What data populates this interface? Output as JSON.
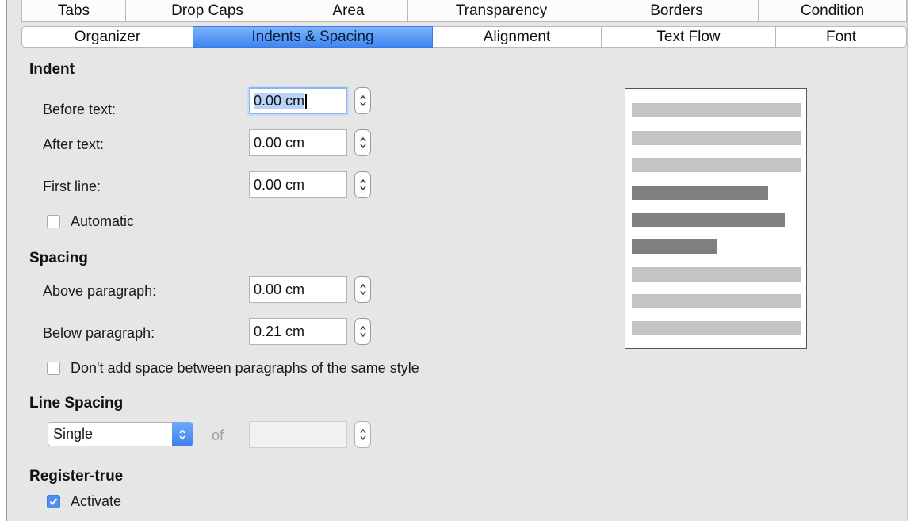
{
  "tabs_top": [
    "Tabs",
    "Drop Caps",
    "Area",
    "Transparency",
    "Borders",
    "Condition"
  ],
  "tabs_bottom": [
    "Organizer",
    "Indents & Spacing",
    "Alignment",
    "Text Flow",
    "Font"
  ],
  "active_tab": "Indents & Spacing",
  "indent": {
    "title": "Indent",
    "before_label": "Before text:",
    "before_value": "0.00 cm",
    "after_label": "After text:",
    "after_value": "0.00 cm",
    "first_label": "First line:",
    "first_value": "0.00 cm",
    "automatic_label": "Automatic",
    "automatic_checked": false
  },
  "spacing": {
    "title": "Spacing",
    "above_label": "Above paragraph:",
    "above_value": "0.00 cm",
    "below_label": "Below paragraph:",
    "below_value": "0.21 cm",
    "no_space_label": "Don't add space between paragraphs of the same style",
    "no_space_checked": false
  },
  "line_spacing": {
    "title": "Line Spacing",
    "selected": "Single",
    "of_label": "of",
    "of_value": ""
  },
  "register_true": {
    "title": "Register-true",
    "activate_label": "Activate",
    "activate_checked": true
  },
  "colors": {
    "accent": "#4d90f4",
    "panel": "#e6e6e6",
    "preview_light": "#c4c4c4",
    "preview_dark": "#808080"
  },
  "icons": {
    "spin": "up-down-stepper-icon",
    "select_arrow": "up-down-chevron-icon",
    "check": "checkmark-icon"
  }
}
